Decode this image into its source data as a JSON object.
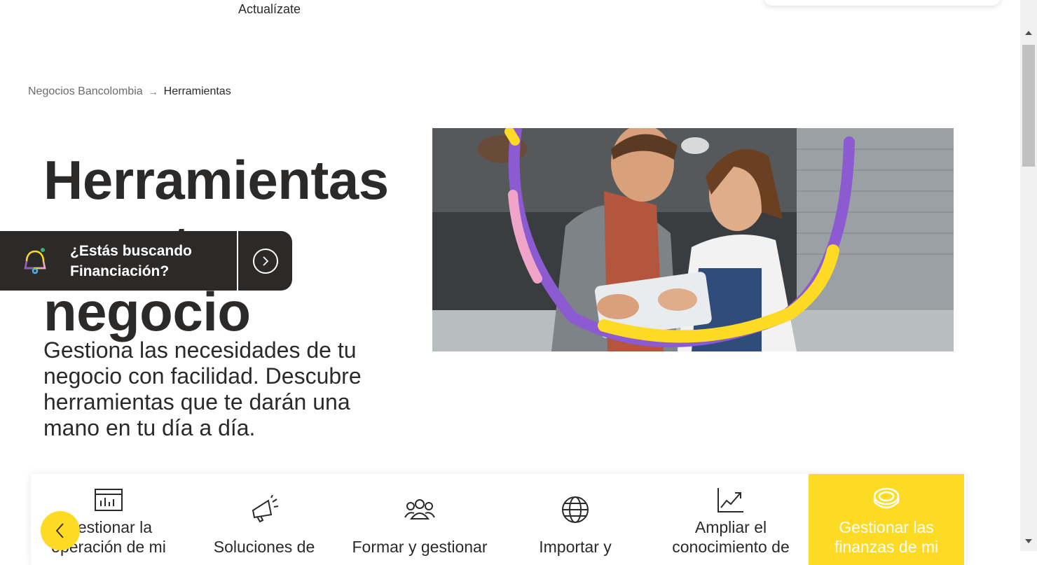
{
  "header": {
    "update_link": "Actualízate"
  },
  "breadcrumb": {
    "home": "Negocios Bancolombia",
    "separator": "→",
    "current": "Herramientas"
  },
  "hero": {
    "title": "Herramientas para tu negocio",
    "description": "Gestiona las necesidades de tu negocio con facilidad. Descubre herramientas que te darán una mano en tu día a día."
  },
  "promo": {
    "text_line1": "¿Estás buscando",
    "text_line2": "Financiación?",
    "icon": "bell-icon"
  },
  "tools": [
    {
      "label_line1": "Gestionar la",
      "label_line2": "operación de mi",
      "icon": "dashboard-icon"
    },
    {
      "label_line1": "",
      "label_line2": "Soluciones de",
      "icon": "megaphone-icon"
    },
    {
      "label_line1": "",
      "label_line2": "Formar y gestionar",
      "icon": "team-icon"
    },
    {
      "label_line1": "",
      "label_line2": "Importar y",
      "icon": "globe-icon"
    },
    {
      "label_line1": "Ampliar el",
      "label_line2": "conocimiento de",
      "icon": "growth-chart-icon"
    },
    {
      "label_line1": "Gestionar las",
      "label_line2": "finanzas de mi",
      "icon": "coin-icon"
    }
  ],
  "colors": {
    "brand_yellow": "#fdda24",
    "dark": "#2c2a29",
    "purple": "#8c5ad1",
    "pink": "#f0a5c8"
  }
}
